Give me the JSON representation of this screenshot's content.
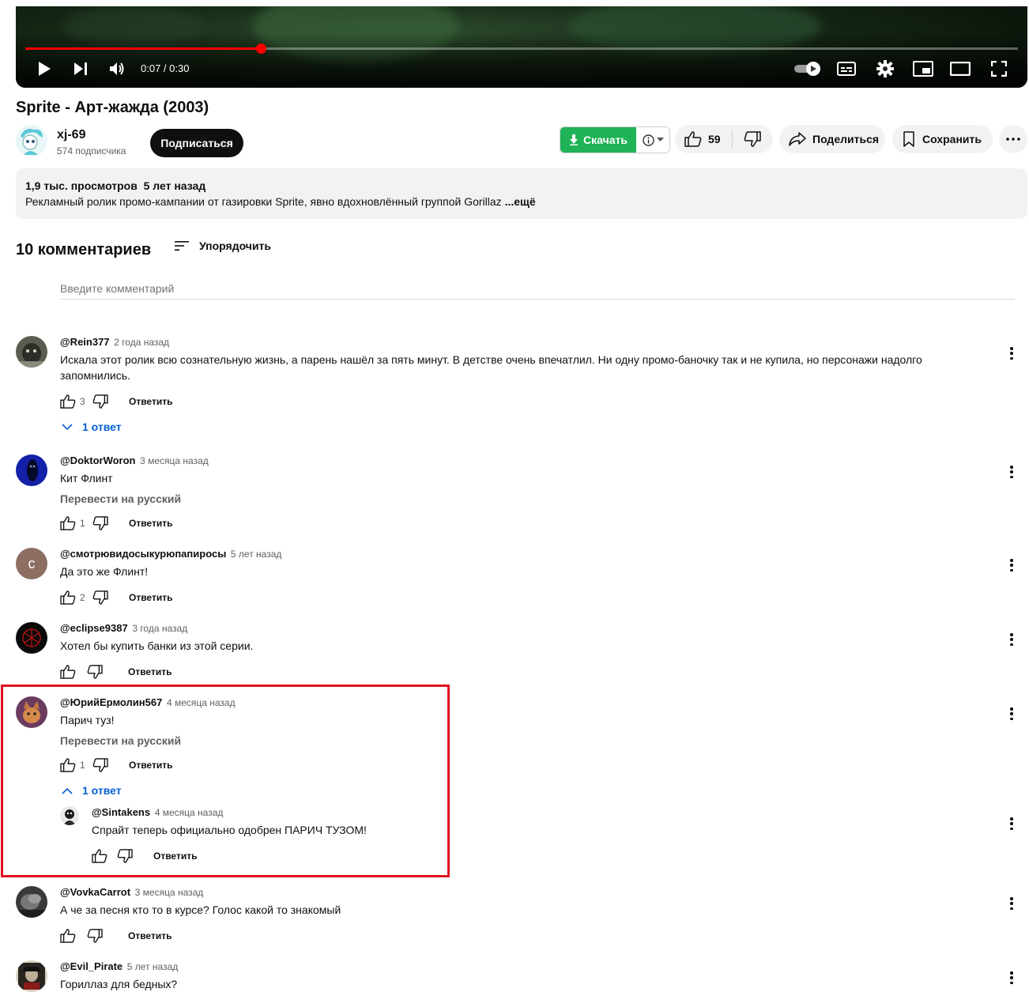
{
  "player": {
    "time": "0:07 / 0:30",
    "progress_fraction": 0.237,
    "icons": [
      "play-icon",
      "next-icon",
      "volume-icon",
      "autoplay-toggle-icon",
      "subtitles-icon",
      "settings-icon",
      "miniplayer-icon",
      "theater-icon",
      "fullscreen-icon"
    ]
  },
  "video": {
    "title": "Sprite - Арт-жажда (2003)"
  },
  "channel": {
    "name": "xj-69",
    "subscribers": "574 подписчика",
    "subscribe_label": "Подписаться"
  },
  "actions": {
    "download_label": "Скачать",
    "like_count": "59",
    "share_label": "Поделиться",
    "save_label": "Сохранить"
  },
  "description": {
    "stats": "1,9 тыс. просмотров  5 лет назад",
    "text": "Рекламный ролик промо-кампании от газировки Sprite, явно вдохновлённый группой Gorillaz ",
    "more": "...ещё"
  },
  "comments_header": {
    "count": "10 комментариев",
    "sort_label": "Упорядочить",
    "input_placeholder": "Введите комментарий"
  },
  "ui": {
    "reply_label": "Ответить",
    "translate_label": "Перевести на русский"
  },
  "comments": [
    {
      "author": "@Rein377",
      "date": "2 года назад",
      "text": "Искала этот ролик всю сознательную жизнь, а парень нашёл за пять минут. В детстве очень впечатлил. Ни одну промо-баночку так и не купила, но персонажи надолго запомнились.",
      "likes": "3",
      "replies_label": "1 ответ"
    },
    {
      "author": "@DoktorWoron",
      "date": "3 месяца назад",
      "text": "Кит Флинт",
      "likes": "1"
    },
    {
      "author": "@смотрювидосыкурюпапиросы",
      "date": "5 лет назад",
      "text": "Да это же Флинт!",
      "likes": "2",
      "avatar_letter": "с"
    },
    {
      "author": "@eclipse9387",
      "date": "3 года назад",
      "text": "Хотел бы купить банки из этой серии.",
      "likes": ""
    },
    {
      "author": "@ЮрийЕрмолин567",
      "date": "4 месяца назад",
      "text": "Парич туз!",
      "likes": "1",
      "replies_label": "1 ответ"
    },
    {
      "author": "@Sintakens",
      "date": "4 месяца назад",
      "text": "Спрайт теперь официально одобрен ПАРИЧ ТУЗОМ!",
      "likes": ""
    },
    {
      "author": "@VovkaCarrot",
      "date": "3 месяца назад",
      "text": "А че за песня кто то в курсе? Голос какой то знакомый",
      "likes": ""
    },
    {
      "author": "@Evil_Pirate",
      "date": "5 лет назад",
      "text": "Гориллаз для бедных?",
      "likes": ""
    }
  ],
  "colors": {
    "progress": "#ff0000",
    "download": "#1fb256",
    "link_blue": "#065fd4",
    "highlight_box": "#e0111f"
  }
}
